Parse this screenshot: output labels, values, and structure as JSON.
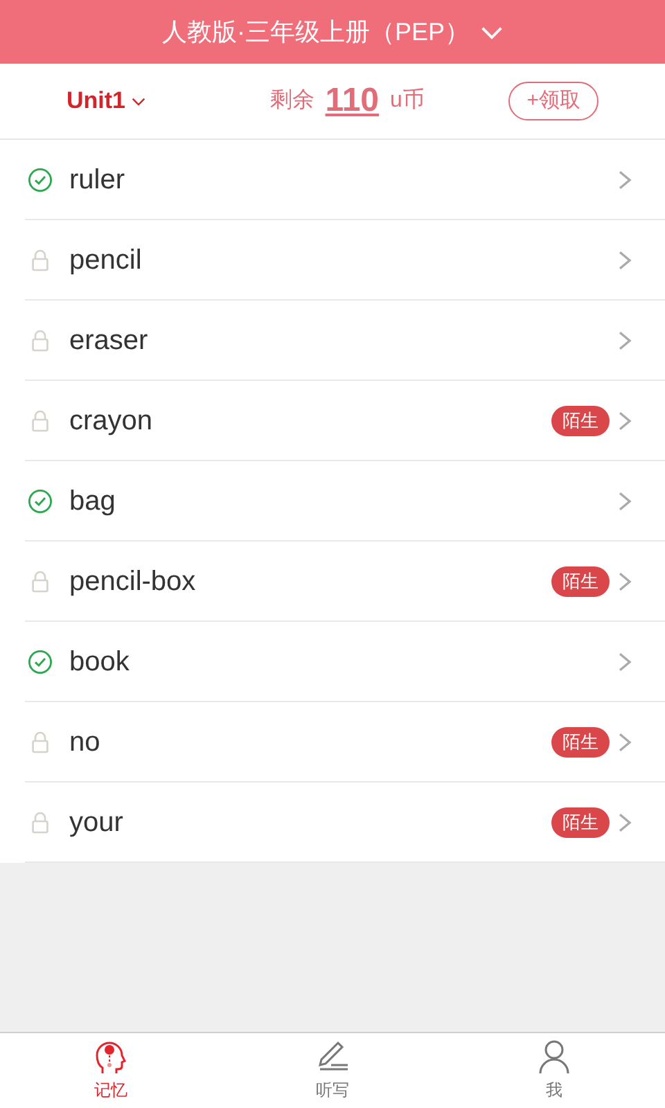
{
  "header": {
    "title": "人教版·三年级上册（PEP）"
  },
  "toolbar": {
    "unit": "Unit1",
    "balance_label": "剩余",
    "balance": "110",
    "currency": "u币",
    "claim_button": "+领取"
  },
  "words": [
    {
      "word": "ruler",
      "kind": "learned"
    },
    {
      "word": "pencil",
      "kind": "locked"
    },
    {
      "word": "eraser",
      "kind": "locked"
    },
    {
      "word": "crayon",
      "kind": "locked",
      "tag": "陌生"
    },
    {
      "word": "bag",
      "kind": "learned"
    },
    {
      "word": "pencil-box",
      "kind": "locked",
      "tag": "陌生"
    },
    {
      "word": "book",
      "kind": "learned"
    },
    {
      "word": "no",
      "kind": "locked",
      "tag": "陌生"
    },
    {
      "word": "your",
      "kind": "locked",
      "tag": "陌生"
    }
  ],
  "bottom_nav": [
    {
      "label": "记忆",
      "kind": "memory",
      "selected": true
    },
    {
      "label": "听写",
      "kind": "dictation",
      "selected": false
    },
    {
      "label": "我",
      "kind": "profile",
      "selected": false
    }
  ]
}
